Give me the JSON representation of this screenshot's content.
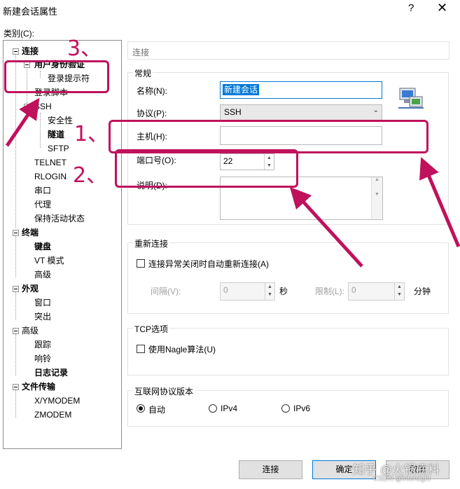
{
  "window": {
    "title": "新建会话属性",
    "help_glyph": "?",
    "close_glyph": "✕"
  },
  "category_label": "类别(C):",
  "tree": {
    "connection": "连接",
    "user_auth": "用户身份验证",
    "login_prompt": "登录提示符",
    "login_script": "登录脚本",
    "ssh": "SSH",
    "security": "安全性",
    "tunnel": "隧道",
    "sftp": "SFTP",
    "telnet": "TELNET",
    "rlogin": "RLOGIN",
    "serial": "串口",
    "proxy": "代理",
    "keepalive": "保持活动状态",
    "terminal": "终端",
    "keyboard": "键盘",
    "vt_mode": "VT 模式",
    "advanced": "高级",
    "appearance": "外观",
    "window": "窗口",
    "highlight": "突出",
    "advanced2": "高级",
    "trace": "跟踪",
    "bell": "响铃",
    "logging": "日志记录",
    "file_transfer": "文件传输",
    "xymodem": "X/YMODEM",
    "zmodem": "ZMODEM"
  },
  "breadcrumb": "连接",
  "general": {
    "group_title": "常规",
    "name_label": "名称(N):",
    "name_value": "新建会话",
    "protocol_label": "协议(P):",
    "protocol_value": "SSH",
    "host_label": "主机(H):",
    "host_value": "",
    "port_label": "端口号(O):",
    "port_value": "22",
    "desc_label": "说明(D):"
  },
  "reconnect": {
    "group_title": "重新连接",
    "checkbox_label": "连接异常关闭时自动重新连接(A)",
    "interval_label": "间隔(V):",
    "interval_value": "0",
    "interval_unit": "秒",
    "limit_label": "限制(L):",
    "limit_value": "0",
    "limit_unit": "分钟"
  },
  "tcp": {
    "group_title": "TCP选项",
    "nagle_label": "使用Nagle算法(U)"
  },
  "ipver": {
    "group_title": "互联网协议版本",
    "auto": "自动",
    "ipv4": "IPv4",
    "ipv6": "IPv6",
    "selected": "自动"
  },
  "buttons": {
    "connect": "连接",
    "ok": "确定",
    "cancel": "取消"
  },
  "annotations": {
    "one": "1、",
    "two": "2、",
    "three": "3、",
    "color": "#c0115c"
  },
  "watermark": {
    "line1": "知乎 @火锅底料",
    "line2": "CSDN @intersight"
  }
}
